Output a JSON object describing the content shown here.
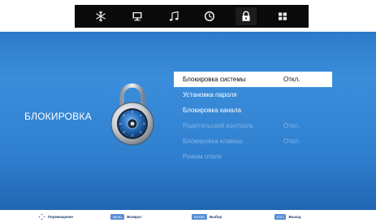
{
  "tabs": [
    {
      "icon": "snowflake-icon"
    },
    {
      "icon": "monitor-icon"
    },
    {
      "icon": "music-note-icon"
    },
    {
      "icon": "clock-icon"
    },
    {
      "icon": "lock-icon",
      "active": true
    },
    {
      "icon": "grid-icon"
    }
  ],
  "section": {
    "title": "БЛОКИРОВКА",
    "icon": "padlock-icon"
  },
  "menu": {
    "items": [
      {
        "label": "Блокировка системы",
        "value": "Откл.",
        "state": "selected"
      },
      {
        "label": "Установка пароля",
        "value": "",
        "state": "enabled"
      },
      {
        "label": "Блокировка канала",
        "value": "",
        "state": "enabled"
      },
      {
        "label": "Родительский контроль",
        "value": "Откл.",
        "state": "disabled"
      },
      {
        "label": "Блокировка клавиш",
        "value": "Откл.",
        "state": "disabled"
      },
      {
        "label": "Режим отеля",
        "value": "",
        "state": "disabled"
      }
    ]
  },
  "hints": {
    "move_label": "Перемещение",
    "back_key": "MENU",
    "back_label": "Возврат",
    "select_key": "ENTER",
    "select_label": "Выбор",
    "exit_key": "EXIT",
    "exit_label": "Выход"
  },
  "colors": {
    "background_top": "#1f5fae",
    "background_mid": "#3b8edb",
    "tab_bar": "#0a0a0a",
    "selected_row": "#ffffff",
    "disabled_text": "#86b4e2",
    "key_badge": "#5b8ed2"
  }
}
